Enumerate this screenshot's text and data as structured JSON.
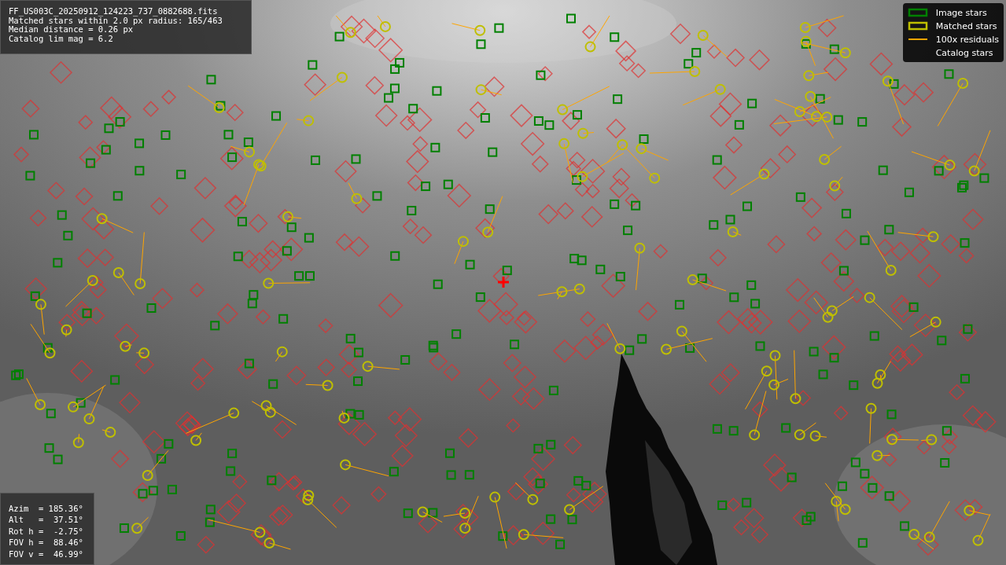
{
  "file_info": {
    "lines": [
      "FF_US003C_20250912_124223_737_0882688.fits",
      "Matched stars within 2.0 px radius: 165/463",
      "Median distance = 0.26 px",
      "Catalog lim mag = 6.2"
    ]
  },
  "legend": {
    "items": [
      {
        "label": "Image stars",
        "kind": "box",
        "color": "#008000"
      },
      {
        "label": "Matched stars",
        "kind": "box",
        "color": "#bfbf00"
      },
      {
        "label": "100x residuals",
        "kind": "line",
        "color": "#ffa500"
      },
      {
        "label": "Catalog stars",
        "kind": "none"
      }
    ]
  },
  "pointing": {
    "lines": [
      "Azim  = 185.36°",
      "Alt   =  37.51°",
      "Rot h =  -2.75°",
      "FOV h =  88.46°",
      "FOV v =  46.99°"
    ]
  }
}
